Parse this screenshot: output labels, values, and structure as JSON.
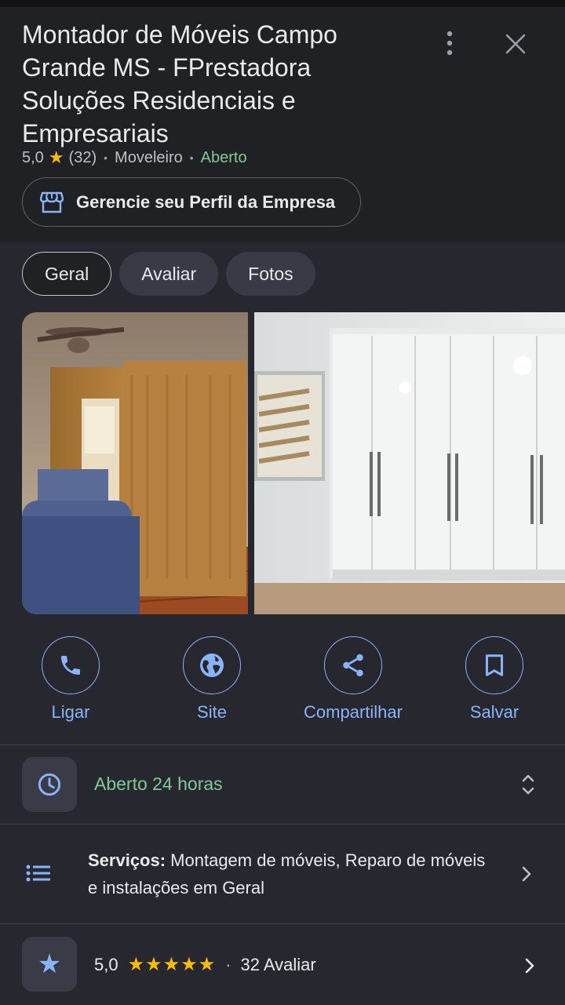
{
  "header": {
    "title": "Montador de Móveis Campo Grande MS - FPrestadora Soluções Residenciais e Empresariais",
    "rating": "5,0",
    "review_count": "(32)",
    "category": "Moveleiro",
    "status": "Aberto",
    "manage_label": "Gerencie seu Perfil da Empresa"
  },
  "tabs": [
    {
      "label": "Geral",
      "active": true
    },
    {
      "label": "Avaliar",
      "active": false
    },
    {
      "label": "Fotos",
      "active": false
    }
  ],
  "actions": [
    {
      "label": "Ligar",
      "icon": "phone-icon"
    },
    {
      "label": "Site",
      "icon": "globe-icon"
    },
    {
      "label": "Compartilhar",
      "icon": "share-icon"
    },
    {
      "label": "Salvar",
      "icon": "bookmark-icon"
    }
  ],
  "hours": {
    "text": "Aberto 24 horas",
    "icon": "clock-icon"
  },
  "services": {
    "label": "Serviços:",
    "text": " Montagem de móveis, Reparo de móveis e instalações em Geral",
    "icon": "list-icon"
  },
  "rating_row": {
    "value": "5,0",
    "stars": "★★★★★",
    "separator": "·",
    "reviews": "32 Avaliar",
    "icon": "star-icon"
  },
  "colors": {
    "accent": "#8ab4f8",
    "open_green": "#81c995",
    "star_yellow": "#fbbc04",
    "background": "#202124"
  }
}
